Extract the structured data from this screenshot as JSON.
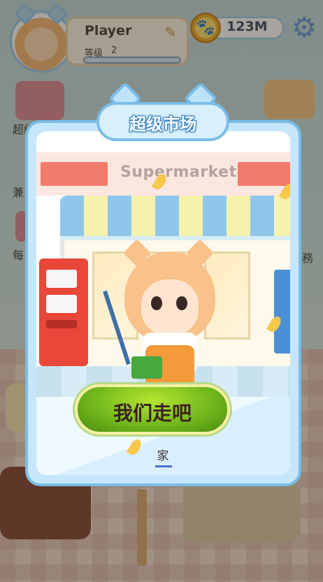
{
  "player": {
    "name": "Player",
    "level_label": "等级",
    "level": "2",
    "xp_fraction": 0.0
  },
  "currency": {
    "coins": "123M",
    "coin_icon": "paw-coin-icon"
  },
  "settings_icon": "gear-icon",
  "background": {
    "left_labels": [
      "超级",
      "兼",
      "每"
    ],
    "right_labels": [
      "務"
    ]
  },
  "dialog": {
    "title": "超级市场",
    "store_sign": "Supermarket",
    "confirm_button": "我们走吧",
    "home_link": "家"
  },
  "colors": {
    "dialog_border": "#79bde8",
    "confirm_button": "#6db51b",
    "title_outline": "#3b84c2"
  }
}
